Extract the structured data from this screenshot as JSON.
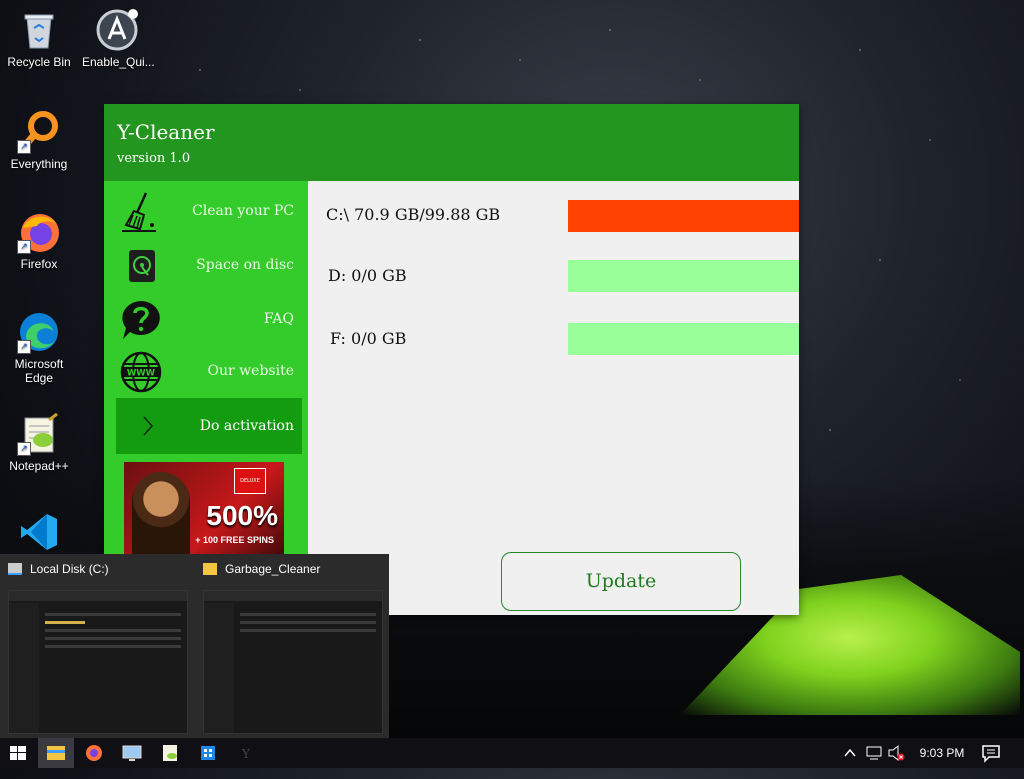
{
  "desktop": {
    "icons": [
      {
        "label": "Recycle Bin"
      },
      {
        "label": "Enable_Qui..."
      },
      {
        "label": "Everything"
      },
      {
        "label": "Firefox"
      },
      {
        "label": "Microsoft Edge"
      },
      {
        "label": "Notepad++"
      }
    ]
  },
  "app": {
    "title": "Y-Cleaner",
    "version": "version 1.0",
    "nav": [
      {
        "label": "Clean your PC",
        "icon": "broom-icon"
      },
      {
        "label": "Space on disc",
        "icon": "hard-drive-icon"
      },
      {
        "label": "FAQ",
        "icon": "question-icon"
      },
      {
        "label": "Our website",
        "icon": "www-globe-icon"
      },
      {
        "label": "Do activation",
        "icon": "chevron-right-icon"
      }
    ],
    "ad": {
      "badge": "DELUXE",
      "big": "500%",
      "small": "+ 100 FREE SPINS"
    },
    "drives": [
      {
        "label": "C:\\ 70.9 GB/99.88 GB",
        "usage_percent": 71,
        "color": "#ff4200"
      },
      {
        "label": "D: 0/0 GB",
        "usage_percent": 0,
        "color": "#99ff99"
      },
      {
        "label": "F: 0/0 GB",
        "usage_percent": 0,
        "color": "#99ff99"
      }
    ],
    "update_label": "Update",
    "colors": {
      "header": "#22961e",
      "sidebar": "#33cc2a",
      "active": "#149c10"
    }
  },
  "preview": {
    "items": [
      {
        "title": "Local Disk (C:)"
      },
      {
        "title": "Garbage_Cleaner"
      }
    ]
  },
  "taskbar": {
    "time": "9:03 PM"
  }
}
